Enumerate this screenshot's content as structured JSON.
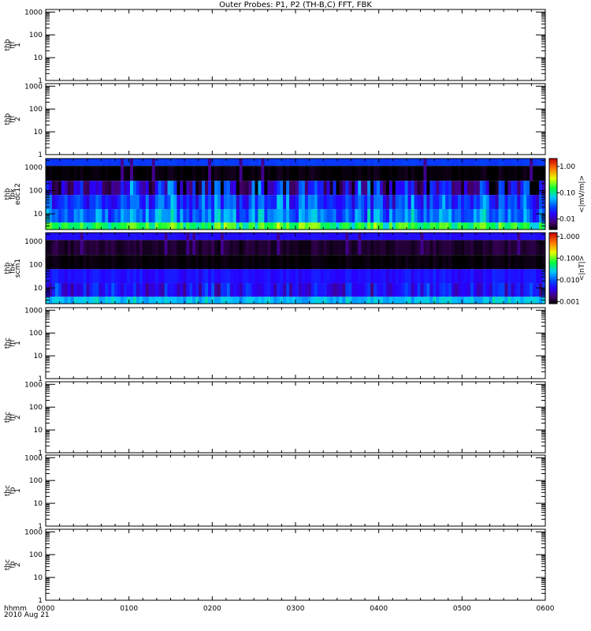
{
  "chart_data": {
    "type": "heatmap",
    "title": "Outer Probes: P1, P2 (TH-B,C) FFT, FBK",
    "x_axis": {
      "label_line1": "hhmm",
      "label_line2": "2010 Aug 21",
      "ticks": [
        "0000",
        "0100",
        "0200",
        "0300",
        "0400",
        "0500",
        "0600"
      ],
      "range_hours": [
        0,
        6
      ],
      "minor_tick_minutes": 10
    },
    "panels": [
      {
        "label": [
          "thb",
          "fff",
          "1"
        ],
        "ylim": [
          1,
          1300
        ],
        "yticks": [
          "1",
          "10",
          "100",
          "1000"
        ],
        "has_data": false
      },
      {
        "label": [
          "thb",
          "fff",
          "2"
        ],
        "ylim": [
          1,
          1300
        ],
        "yticks": [
          "1",
          "10",
          "100",
          "1000"
        ],
        "has_data": false
      },
      {
        "label": [
          "thb",
          "fbk",
          "edc12"
        ],
        "ylim": [
          2.1,
          2400
        ],
        "yticks": [
          "10",
          "100",
          "1000"
        ],
        "has_data": true,
        "zlim": [
          0.004,
          2
        ],
        "colorbar_ticks": [
          "1.00",
          "0.10",
          "0.01"
        ],
        "colorbar_title": "<|mV/m|>",
        "bands": [
          {
            "f_lo": 2.1,
            "f_hi": 4.2,
            "value": 0.15,
            "spread": 0.25
          },
          {
            "f_lo": 4.2,
            "f_hi": 16,
            "value": 0.04,
            "spread": 0.3
          },
          {
            "f_lo": 16,
            "f_hi": 65,
            "value": 0.026,
            "spread": 0.3
          },
          {
            "f_lo": 65,
            "f_hi": 265,
            "value": 0.012,
            "spread": 0.55
          },
          {
            "f_lo": 265,
            "f_hi": 1170,
            "value": 0.0042,
            "spread": 0.05
          },
          {
            "f_lo": 1170,
            "f_hi": 2400,
            "value": 0.026,
            "spread": 0.03
          }
        ]
      },
      {
        "label": [
          "thb",
          "fbk",
          "scm1"
        ],
        "ylim": [
          2.1,
          2400
        ],
        "yticks": [
          "10",
          "100",
          "1000"
        ],
        "has_data": true,
        "zlim": [
          0.0008,
          1.5
        ],
        "colorbar_ticks": [
          "1.000",
          "0.100",
          "0.010",
          "0.001"
        ],
        "colorbar_title": "<|nT|>",
        "bands": [
          {
            "f_lo": 2.1,
            "f_hi": 4.2,
            "value": 0.022,
            "spread": 0.15
          },
          {
            "f_lo": 4.2,
            "f_hi": 16,
            "value": 0.0045,
            "spread": 0.3
          },
          {
            "f_lo": 16,
            "f_hi": 65,
            "value": 0.0048,
            "spread": 0.1
          },
          {
            "f_lo": 65,
            "f_hi": 265,
            "value": 0.00085,
            "spread": 0.05
          },
          {
            "f_lo": 265,
            "f_hi": 1170,
            "value": 0.0011,
            "spread": 0.08
          },
          {
            "f_lo": 1170,
            "f_hi": 2400,
            "value": 0.0048,
            "spread": 0.03
          }
        ]
      },
      {
        "label": [
          "thc",
          "fff",
          "1"
        ],
        "ylim": [
          1,
          1300
        ],
        "yticks": [
          "1",
          "10",
          "100",
          "1000"
        ],
        "has_data": false
      },
      {
        "label": [
          "thc",
          "fff",
          "2"
        ],
        "ylim": [
          1,
          1300
        ],
        "yticks": [
          "1",
          "10",
          "100",
          "1000"
        ],
        "has_data": false
      },
      {
        "label": [
          "thc",
          "fb",
          "1"
        ],
        "ylim": [
          1,
          1300
        ],
        "yticks": [
          "1",
          "10",
          "100",
          "1000"
        ],
        "has_data": false
      },
      {
        "label": [
          "thc",
          "fb",
          "2"
        ],
        "ylim": [
          1,
          1300
        ],
        "yticks": [
          "1",
          "10",
          "100",
          "1000"
        ],
        "has_data": false
      }
    ]
  }
}
